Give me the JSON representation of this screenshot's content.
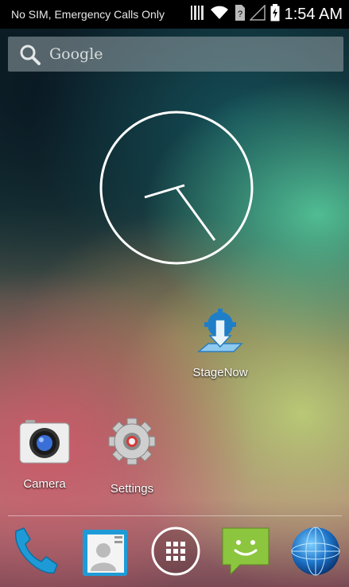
{
  "statusbar": {
    "carrier": "No SIM, Emergency Calls Only",
    "time": "1:54 AM"
  },
  "search": {
    "label": "Google",
    "icon": "search-icon"
  },
  "apps": {
    "stagenow": "StageNow",
    "camera": "Camera",
    "settings": "Settings"
  },
  "dock": {
    "items": [
      "phone-icon",
      "contacts-icon",
      "app-drawer-icon",
      "messaging-icon",
      "browser-icon"
    ]
  },
  "colors": {
    "statusbar_bg": "#000000",
    "phone_blue": "#1e9bd7",
    "messaging_green": "#8cc63f"
  }
}
